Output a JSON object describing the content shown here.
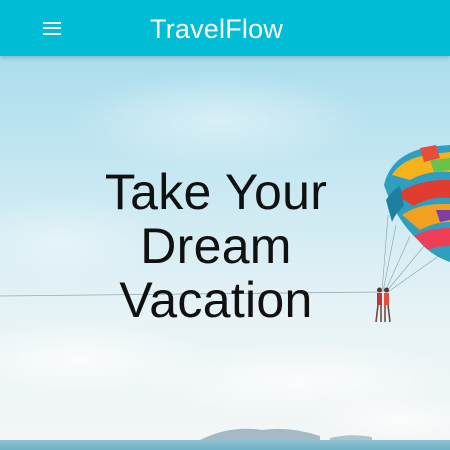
{
  "app": {
    "title": "TravelFlow",
    "brand_color": "#00bcd4"
  },
  "toolbar": {
    "menu_icon": "menu-icon"
  },
  "hero": {
    "headline_lines": [
      "Take Your",
      "Dream",
      "Vacation"
    ]
  }
}
